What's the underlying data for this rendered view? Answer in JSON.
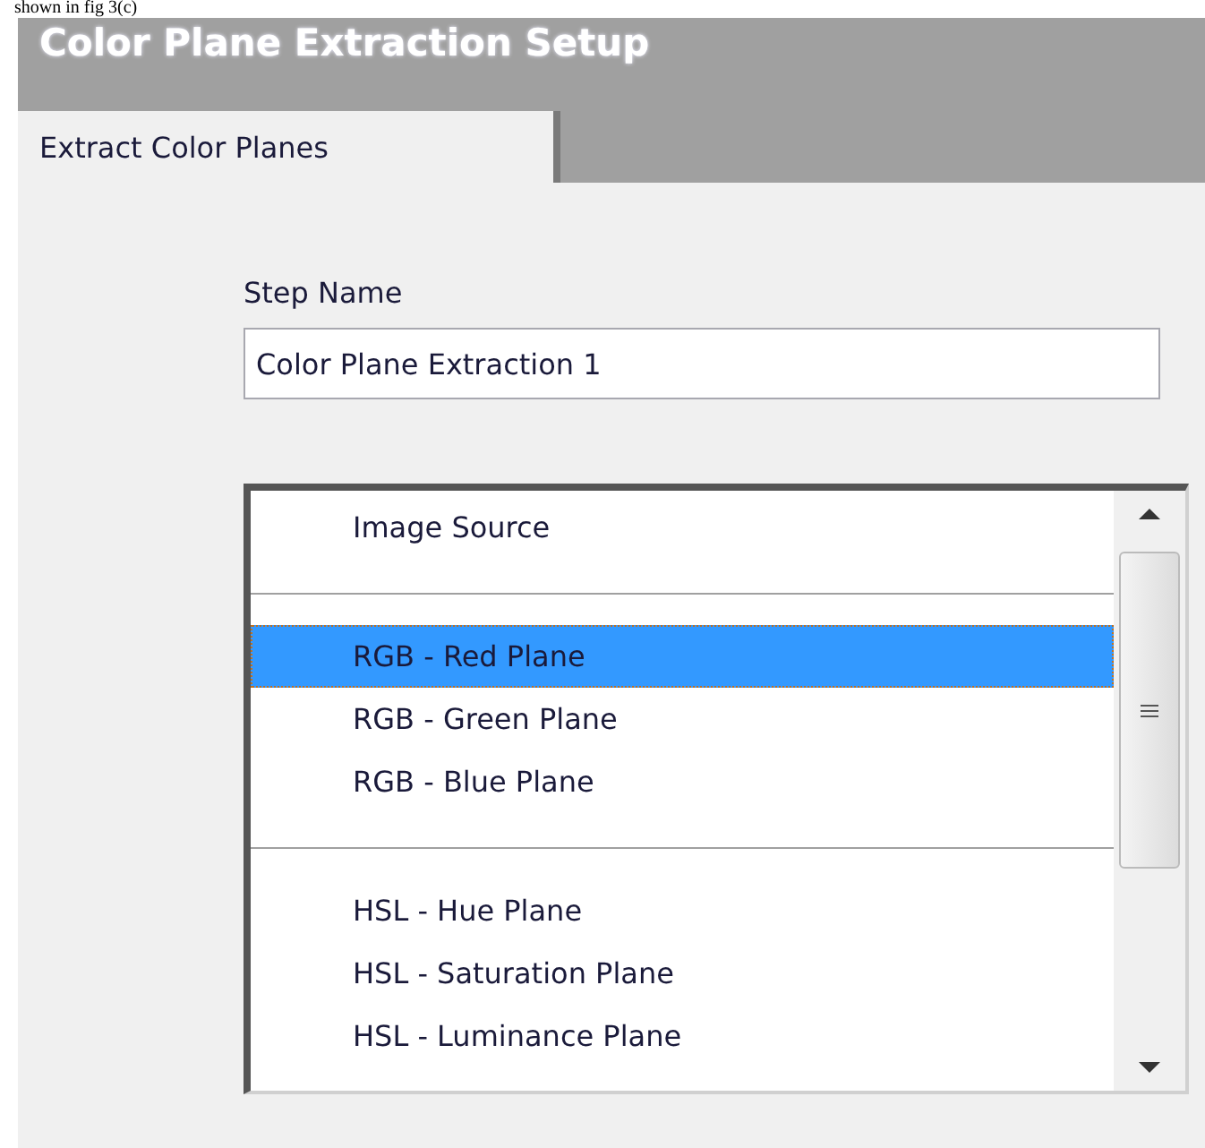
{
  "caption": "shown in fig 3(c)",
  "window": {
    "title": "Color Plane Extraction Setup"
  },
  "tabs": [
    {
      "label": "Extract Color Planes",
      "selected": true
    }
  ],
  "step_name": {
    "label": "Step Name",
    "value": "Color Plane Extraction 1"
  },
  "plane_list": {
    "groups": [
      {
        "items": [
          {
            "label": "Image Source",
            "selected": false
          }
        ]
      },
      {
        "items": [
          {
            "label": "RGB - Red Plane",
            "selected": true
          },
          {
            "label": "RGB - Green Plane",
            "selected": false
          },
          {
            "label": "RGB - Blue Plane",
            "selected": false
          }
        ]
      },
      {
        "items": [
          {
            "label": "HSL - Hue Plane",
            "selected": false
          },
          {
            "label": "HSL - Saturation Plane",
            "selected": false
          },
          {
            "label": "HSL - Luminance Plane",
            "selected": false
          }
        ]
      }
    ]
  }
}
